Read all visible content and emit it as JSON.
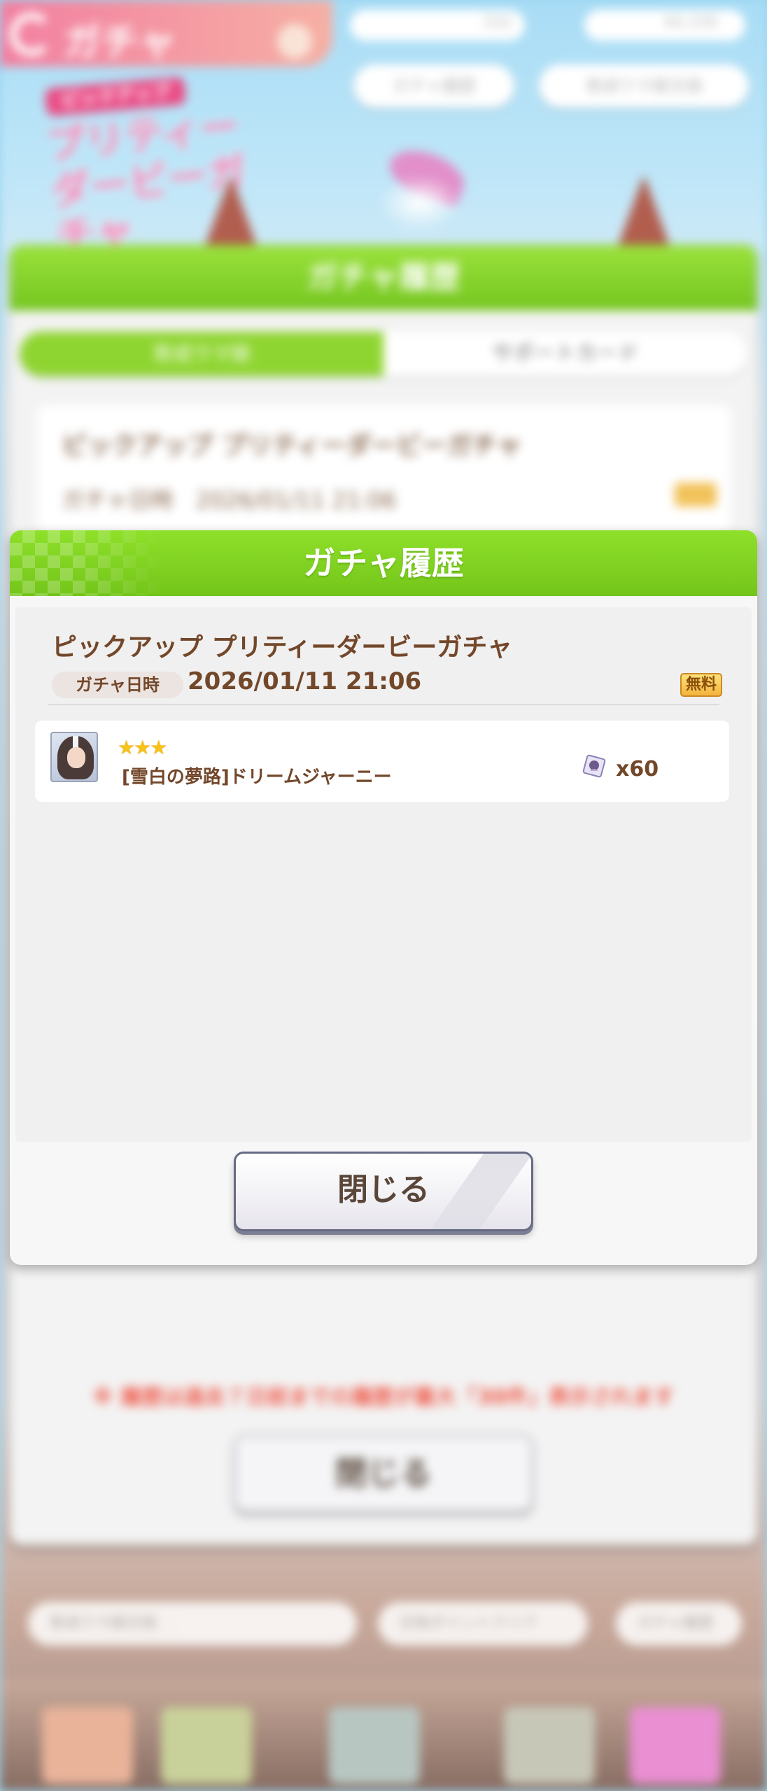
{
  "background": {
    "header_title": "ガチャ",
    "currency_1": "332",
    "currency_2": "44,339",
    "history_button": "ガチャ履歴",
    "exchange_button": "育成ウマ娘交換",
    "banner_tag": "ピックアップ",
    "banner_title": "プリティーダービーガチャ",
    "panel_title": "ガチャ履歴",
    "tab_active": "育成ウマ娘",
    "tab_inactive": "サポートカード",
    "entry_title": "ピックアップ プリティーダービーガチャ",
    "entry_date_label": "ガチャ日時",
    "entry_date": "2026/01/11 21:06",
    "notice": "※ 履歴は過去７日前までの履歴が最大「30件」表示されます",
    "close_label": "閉じる",
    "bottom_left": "育成ウマ娘交換",
    "bottom_mid": "交換ポイントクリア",
    "bottom_right": "ガチャ履歴"
  },
  "modal": {
    "title": "ガチャ履歴",
    "gacha_name": "ピックアップ プリティーダービーガチャ",
    "date_label": "ガチャ日時",
    "date_value": "2026/01/11 21:06",
    "free_badge": "無料",
    "results": [
      {
        "rarity": "★★★",
        "name": "[雪白の夢路]ドリームジャーニー",
        "piece_count": "x60"
      }
    ],
    "close_label": "閉じる"
  },
  "colors": {
    "header_green": "#74c51a",
    "text_brown": "#73472a",
    "star_gold": "#f7c21a"
  }
}
